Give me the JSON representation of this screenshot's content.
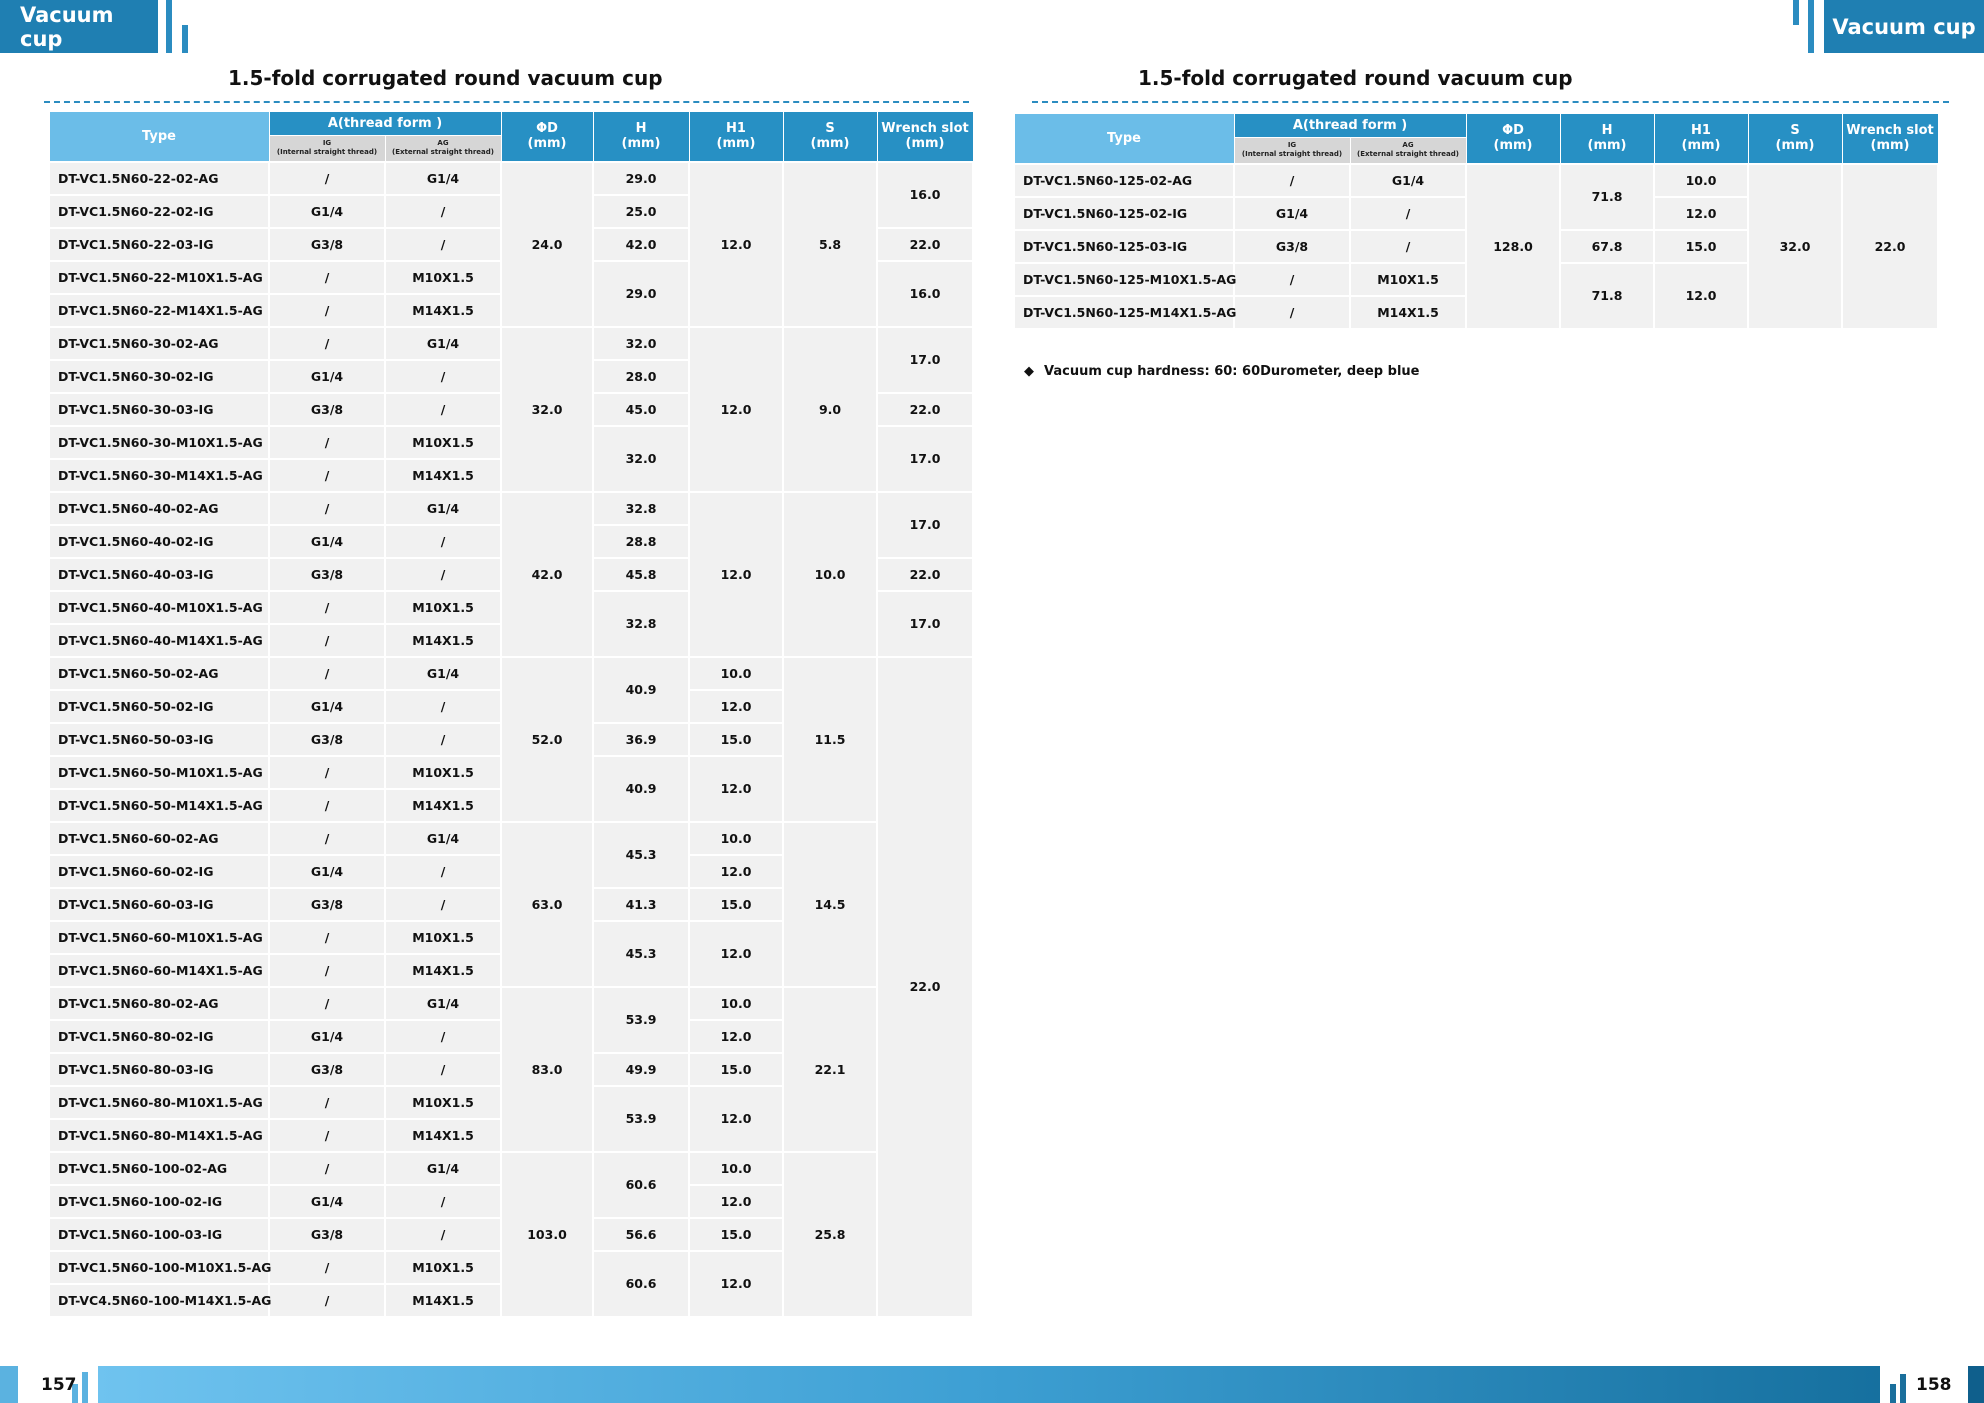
{
  "header": {
    "left_badge": "Vacuum cup",
    "right_badge": "Vacuum cup"
  },
  "left": {
    "title": "1.5-fold corrugated round vacuum cup",
    "head": {
      "type": "Type",
      "thread": "A(thread form )",
      "ig": "IG",
      "ig_sub": "(Internal straight thread)",
      "ag": "AG",
      "ag_sub": "(External straight thread)",
      "d": "ΦD",
      "d_unit": "(mm)",
      "h": "H",
      "h_unit": "(mm)",
      "h1": "H1",
      "h1_unit": "(mm)",
      "s": "S",
      "s_unit": "(mm)",
      "w": "Wrench slot",
      "w_unit": "(mm)"
    },
    "rows": [
      {
        "type": "DT-VC1.5N60-22-02-AG",
        "ig": "/",
        "ag": "G1/4"
      },
      {
        "type": "DT-VC1.5N60-22-02-IG",
        "ig": "G1/4",
        "ag": "/"
      },
      {
        "type": "DT-VC1.5N60-22-03-IG",
        "ig": "G3/8",
        "ag": "/"
      },
      {
        "type": "DT-VC1.5N60-22-M10X1.5-AG",
        "ig": "/",
        "ag": "M10X1.5"
      },
      {
        "type": "DT-VC1.5N60-22-M14X1.5-AG",
        "ig": "/",
        "ag": "M14X1.5"
      },
      {
        "type": "DT-VC1.5N60-30-02-AG",
        "ig": "/",
        "ag": "G1/4"
      },
      {
        "type": "DT-VC1.5N60-30-02-IG",
        "ig": "G1/4",
        "ag": "/"
      },
      {
        "type": "DT-VC1.5N60-30-03-IG",
        "ig": "G3/8",
        "ag": "/"
      },
      {
        "type": "DT-VC1.5N60-30-M10X1.5-AG",
        "ig": "/",
        "ag": "M10X1.5"
      },
      {
        "type": "DT-VC1.5N60-30-M14X1.5-AG",
        "ig": "/",
        "ag": "M14X1.5"
      },
      {
        "type": "DT-VC1.5N60-40-02-AG",
        "ig": "/",
        "ag": "G1/4"
      },
      {
        "type": "DT-VC1.5N60-40-02-IG",
        "ig": "G1/4",
        "ag": "/"
      },
      {
        "type": "DT-VC1.5N60-40-03-IG",
        "ig": "G3/8",
        "ag": "/"
      },
      {
        "type": "DT-VC1.5N60-40-M10X1.5-AG",
        "ig": "/",
        "ag": "M10X1.5"
      },
      {
        "type": "DT-VC1.5N60-40-M14X1.5-AG",
        "ig": "/",
        "ag": "M14X1.5"
      },
      {
        "type": "DT-VC1.5N60-50-02-AG",
        "ig": "/",
        "ag": "G1/4"
      },
      {
        "type": "DT-VC1.5N60-50-02-IG",
        "ig": "G1/4",
        "ag": "/"
      },
      {
        "type": "DT-VC1.5N60-50-03-IG",
        "ig": "G3/8",
        "ag": "/"
      },
      {
        "type": "DT-VC1.5N60-50-M10X1.5-AG",
        "ig": "/",
        "ag": "M10X1.5"
      },
      {
        "type": "DT-VC1.5N60-50-M14X1.5-AG",
        "ig": "/",
        "ag": "M14X1.5"
      },
      {
        "type": "DT-VC1.5N60-60-02-AG",
        "ig": "/",
        "ag": "G1/4"
      },
      {
        "type": "DT-VC1.5N60-60-02-IG",
        "ig": "G1/4",
        "ag": "/"
      },
      {
        "type": "DT-VC1.5N60-60-03-IG",
        "ig": "G3/8",
        "ag": "/"
      },
      {
        "type": "DT-VC1.5N60-60-M10X1.5-AG",
        "ig": "/",
        "ag": "M10X1.5"
      },
      {
        "type": "DT-VC1.5N60-60-M14X1.5-AG",
        "ig": "/",
        "ag": "M14X1.5"
      },
      {
        "type": "DT-VC1.5N60-80-02-AG",
        "ig": "/",
        "ag": "G1/4"
      },
      {
        "type": "DT-VC1.5N60-80-02-IG",
        "ig": "G1/4",
        "ag": "/"
      },
      {
        "type": "DT-VC1.5N60-80-03-IG",
        "ig": "G3/8",
        "ag": "/"
      },
      {
        "type": "DT-VC1.5N60-80-M10X1.5-AG",
        "ig": "/",
        "ag": "M10X1.5"
      },
      {
        "type": "DT-VC1.5N60-80-M14X1.5-AG",
        "ig": "/",
        "ag": "M14X1.5"
      },
      {
        "type": "DT-VC1.5N60-100-02-AG",
        "ig": "/",
        "ag": "G1/4"
      },
      {
        "type": "DT-VC1.5N60-100-02-IG",
        "ig": "G1/4",
        "ag": "/"
      },
      {
        "type": "DT-VC1.5N60-100-03-IG",
        "ig": "G3/8",
        "ag": "/"
      },
      {
        "type": "DT-VC1.5N60-100-M10X1.5-AG",
        "ig": "/",
        "ag": "M10X1.5"
      },
      {
        "type": "DT-VC4.5N60-100-M14X1.5-AG",
        "ig": "/",
        "ag": "M14X1.5"
      }
    ],
    "d": [
      {
        "v": "24.0",
        "span": 5
      },
      {
        "v": "32.0",
        "span": 5
      },
      {
        "v": "42.0",
        "span": 5
      },
      {
        "v": "52.0",
        "span": 5
      },
      {
        "v": "63.0",
        "span": 5
      },
      {
        "v": "83.0",
        "span": 5
      },
      {
        "v": "103.0",
        "span": 5
      }
    ],
    "h": [
      {
        "v": "29.0",
        "span": 1
      },
      {
        "v": "25.0",
        "span": 1
      },
      {
        "v": "42.0",
        "span": 1
      },
      {
        "v": "29.0",
        "span": 2
      },
      {
        "v": "32.0",
        "span": 1
      },
      {
        "v": "28.0",
        "span": 1
      },
      {
        "v": "45.0",
        "span": 1
      },
      {
        "v": "32.0",
        "span": 2
      },
      {
        "v": "32.8",
        "span": 1
      },
      {
        "v": "28.8",
        "span": 1
      },
      {
        "v": "45.8",
        "span": 1
      },
      {
        "v": "32.8",
        "span": 2
      },
      {
        "v": "40.9",
        "span": 2
      },
      {
        "v": "36.9",
        "span": 1
      },
      {
        "v": "40.9",
        "span": 2
      },
      {
        "v": "45.3",
        "span": 2
      },
      {
        "v": "41.3",
        "span": 1
      },
      {
        "v": "45.3",
        "span": 2
      },
      {
        "v": "53.9",
        "span": 2
      },
      {
        "v": "49.9",
        "span": 1
      },
      {
        "v": "53.9",
        "span": 2
      },
      {
        "v": "60.6",
        "span": 2
      },
      {
        "v": "56.6",
        "span": 1
      },
      {
        "v": "60.6",
        "span": 2
      }
    ],
    "h1": [
      {
        "v": "12.0",
        "span": 5
      },
      {
        "v": "12.0",
        "span": 5
      },
      {
        "v": "12.0",
        "span": 5
      },
      {
        "v": "10.0",
        "span": 1
      },
      {
        "v": "12.0",
        "span": 1
      },
      {
        "v": "15.0",
        "span": 1
      },
      {
        "v": "12.0",
        "span": 2
      },
      {
        "v": "10.0",
        "span": 1
      },
      {
        "v": "12.0",
        "span": 1
      },
      {
        "v": "15.0",
        "span": 1
      },
      {
        "v": "12.0",
        "span": 2
      },
      {
        "v": "10.0",
        "span": 1
      },
      {
        "v": "12.0",
        "span": 1
      },
      {
        "v": "15.0",
        "span": 1
      },
      {
        "v": "12.0",
        "span": 2
      },
      {
        "v": "10.0",
        "span": 1
      },
      {
        "v": "12.0",
        "span": 1
      },
      {
        "v": "15.0",
        "span": 1
      },
      {
        "v": "12.0",
        "span": 2
      }
    ],
    "s": [
      {
        "v": "5.8",
        "span": 5
      },
      {
        "v": "9.0",
        "span": 5
      },
      {
        "v": "10.0",
        "span": 5
      },
      {
        "v": "11.5",
        "span": 5
      },
      {
        "v": "14.5",
        "span": 5
      },
      {
        "v": "22.1",
        "span": 5
      },
      {
        "v": "25.8",
        "span": 5
      }
    ],
    "w": [
      {
        "v": "16.0",
        "span": 2
      },
      {
        "v": "22.0",
        "span": 1
      },
      {
        "v": "16.0",
        "span": 2
      },
      {
        "v": "17.0",
        "span": 2
      },
      {
        "v": "22.0",
        "span": 1
      },
      {
        "v": "17.0",
        "span": 2
      },
      {
        "v": "17.0",
        "span": 2
      },
      {
        "v": "22.0",
        "span": 1
      },
      {
        "v": "17.0",
        "span": 2
      },
      {
        "v": "22.0",
        "span": 20
      }
    ]
  },
  "right": {
    "title": "1.5-fold corrugated round vacuum cup",
    "head": {
      "type": "Type",
      "thread": "A(thread form )",
      "ig": "IG",
      "ig_sub": "(Internal straight thread)",
      "ag": "AG",
      "ag_sub": "(External straight thread)",
      "d": "ΦD",
      "d_unit": "(mm)",
      "h": "H",
      "h_unit": "(mm)",
      "h1": "H1",
      "h1_unit": "(mm)",
      "s": "S",
      "s_unit": "(mm)",
      "w": "Wrench slot",
      "w_unit": "(mm)"
    },
    "rows": [
      {
        "type": "DT-VC1.5N60-125-02-AG",
        "ig": "/",
        "ag": "G1/4"
      },
      {
        "type": "DT-VC1.5N60-125-02-IG",
        "ig": "G1/4",
        "ag": "/"
      },
      {
        "type": "DT-VC1.5N60-125-03-IG",
        "ig": "G3/8",
        "ag": "/"
      },
      {
        "type": "DT-VC1.5N60-125-M10X1.5-AG",
        "ig": "/",
        "ag": "M10X1.5"
      },
      {
        "type": "DT-VC1.5N60-125-M14X1.5-AG",
        "ig": "/",
        "ag": "M14X1.5"
      }
    ],
    "d": [
      {
        "v": "128.0",
        "span": 5
      }
    ],
    "h": [
      {
        "v": "71.8",
        "span": 2
      },
      {
        "v": "67.8",
        "span": 1
      },
      {
        "v": "71.8",
        "span": 2
      }
    ],
    "h1": [
      {
        "v": "10.0",
        "span": 1
      },
      {
        "v": "12.0",
        "span": 1
      },
      {
        "v": "15.0",
        "span": 1
      },
      {
        "v": "12.0",
        "span": 2
      }
    ],
    "s": [
      {
        "v": "32.0",
        "span": 5
      }
    ],
    "w": [
      {
        "v": "22.0",
        "span": 5
      }
    ]
  },
  "note": {
    "symbol": "◆",
    "text": "Vacuum cup hardness:    60:    60Durometer,  deep blue"
  },
  "footer": {
    "left_page": "157",
    "right_page": "158"
  }
}
